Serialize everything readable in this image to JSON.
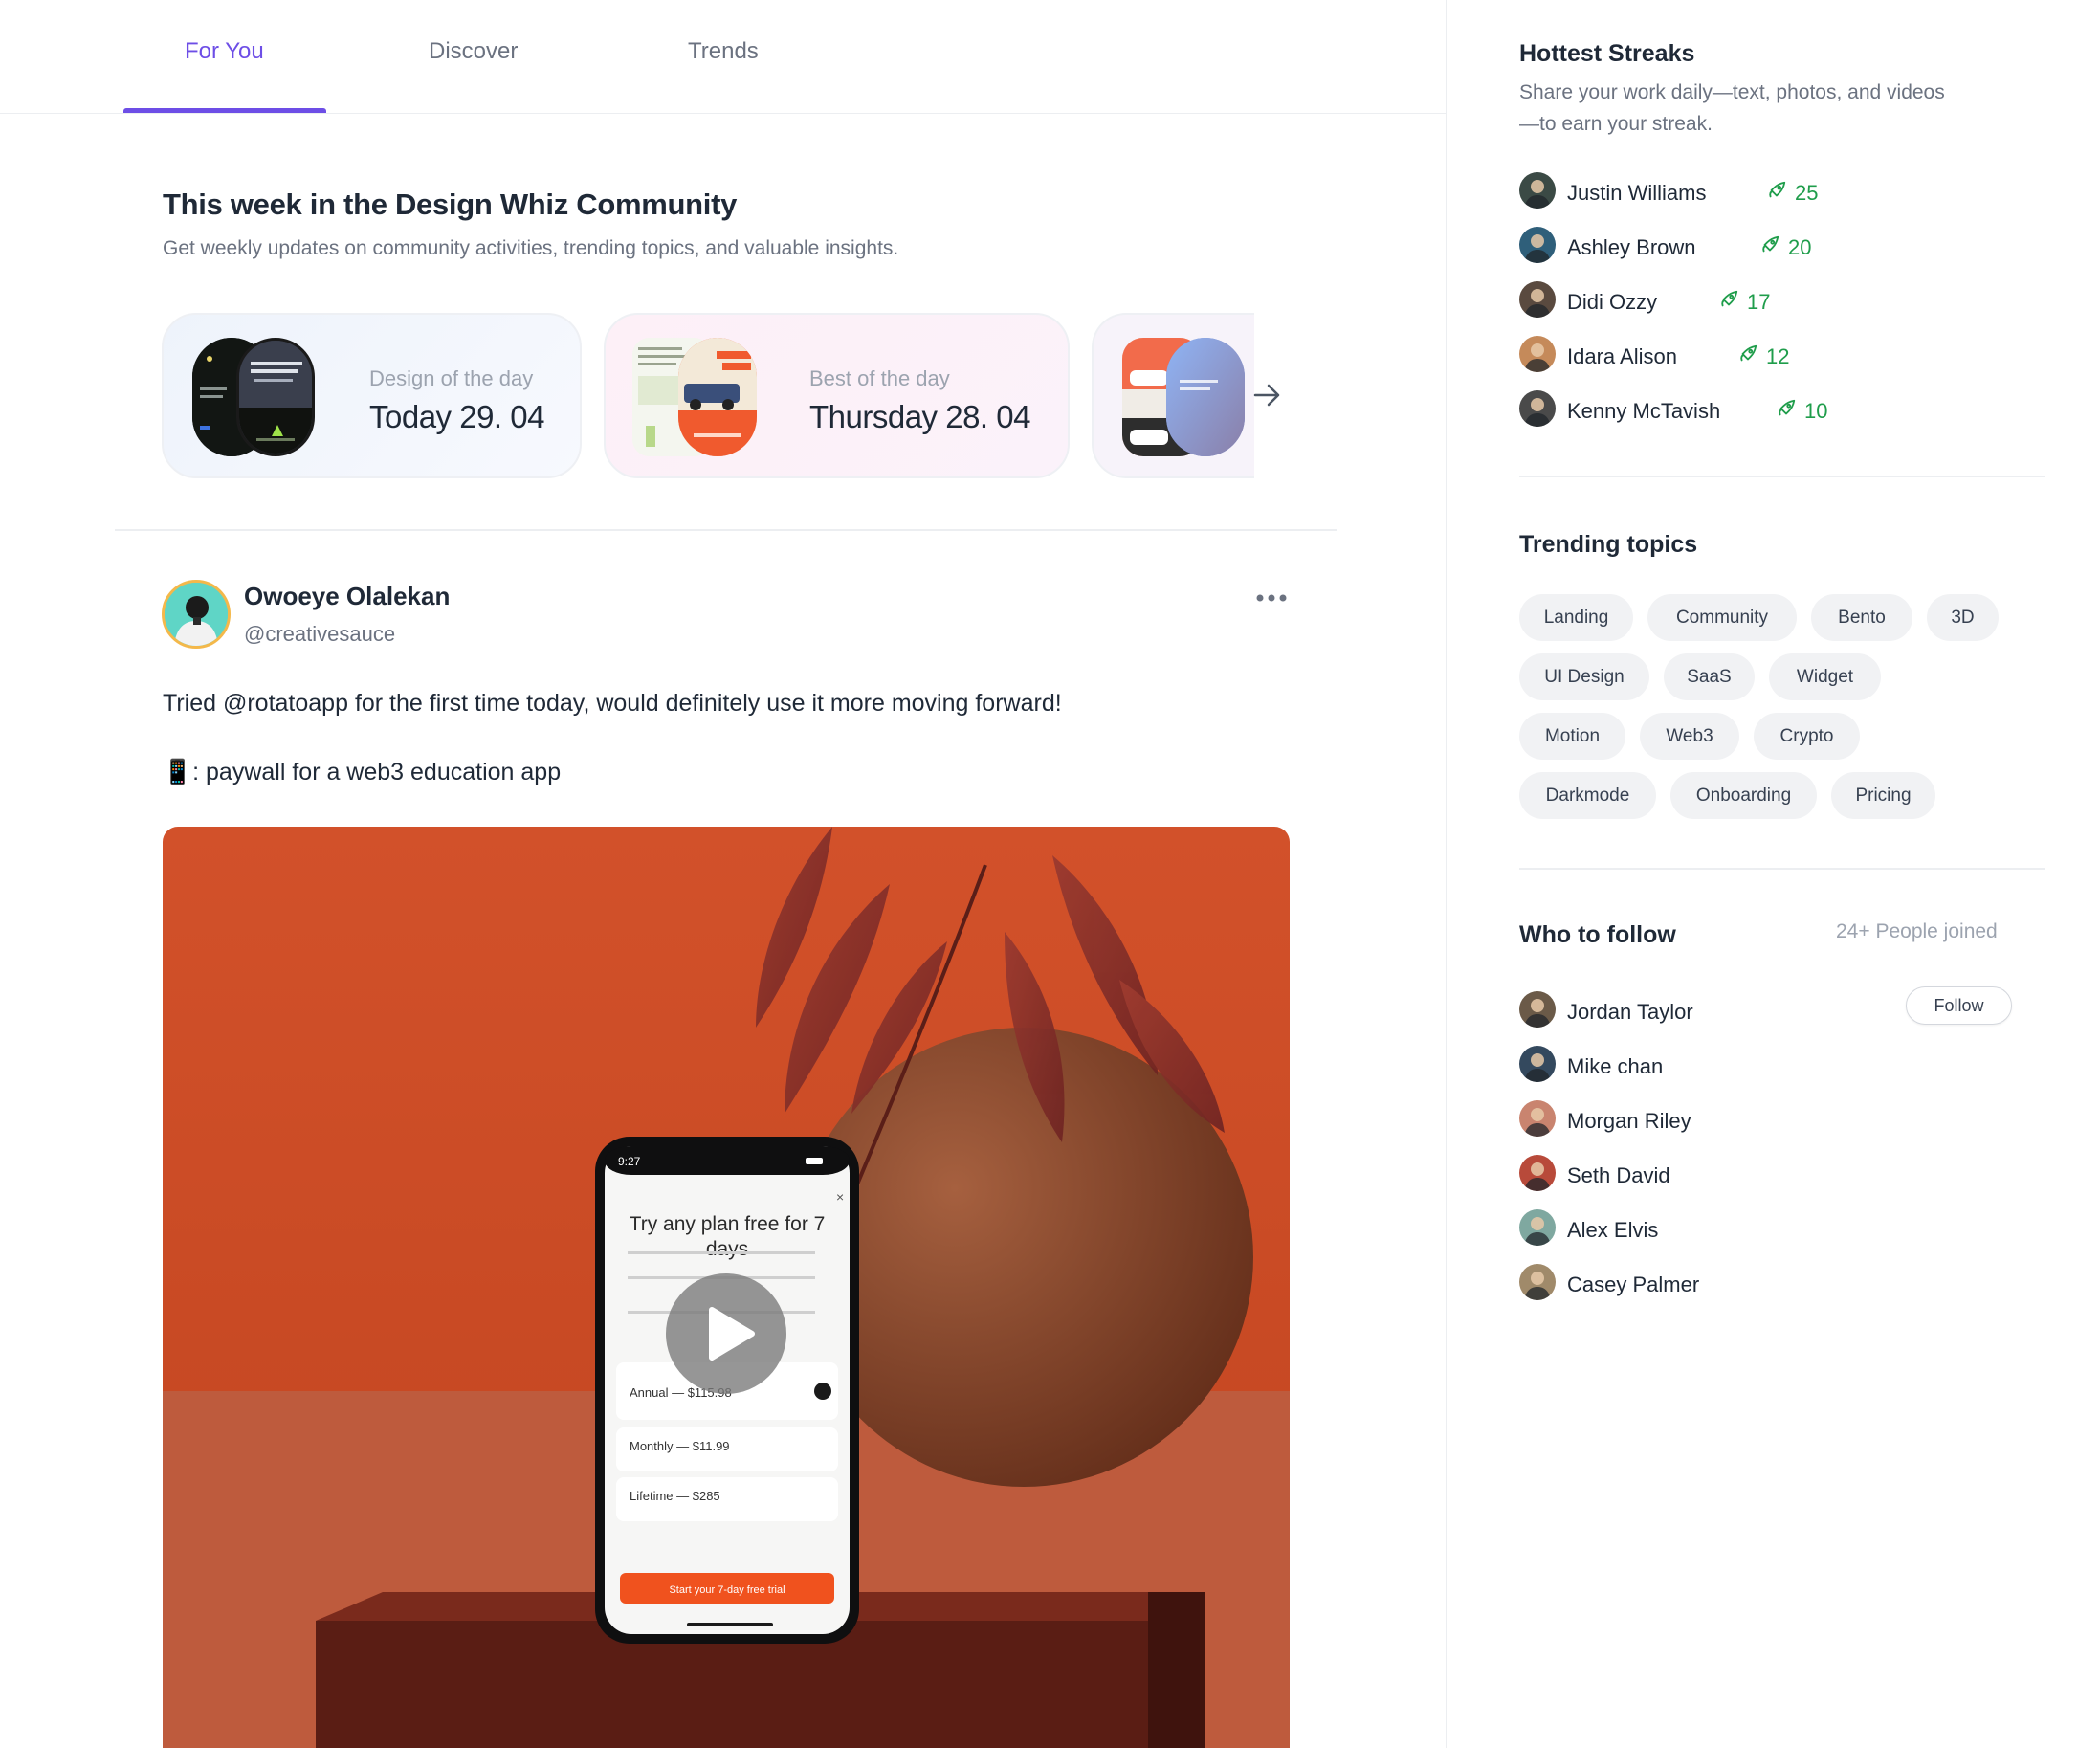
{
  "tabs": [
    {
      "label": "For You",
      "active": true
    },
    {
      "label": "Discover",
      "active": false
    },
    {
      "label": "Trends",
      "active": false
    }
  ],
  "weekly": {
    "title": "This week in the Design Whiz Community",
    "subtitle": "Get weekly updates on community activities, trending topics, and valuable insights.",
    "cards": [
      {
        "label": "Design of the day",
        "date": "Today 29. 04"
      },
      {
        "label": "Best of the day",
        "date": "Thursday 28. 04"
      }
    ]
  },
  "post": {
    "author": "Owoeye Olalekan",
    "handle": "@creativesauce",
    "text1": "Tried  @rotatoapp  for the first time today, would definitely use it more moving forward!",
    "text2": "📱: paywall for a web3 education app",
    "media": {
      "status_time": "9:27",
      "heading": "Try any plan free for 7 days",
      "plans": [
        "Annual — $115.98",
        "Monthly — $11.99",
        "Lifetime — $285"
      ],
      "cta": "Start your 7-day free trial"
    }
  },
  "streaks": {
    "title": "Hottest Streaks",
    "subtitle": "Share your work daily—text, photos, and videos—to earn your streak.",
    "people": [
      {
        "name": "Justin Williams",
        "count": "25",
        "avatar_color": "#3b4a45"
      },
      {
        "name": "Ashley Brown",
        "count": "20",
        "avatar_color": "#2f5f7a"
      },
      {
        "name": "Didi Ozzy",
        "count": "17",
        "avatar_color": "#5a4a3f"
      },
      {
        "name": "Idara Alison",
        "count": "12",
        "avatar_color": "#c58a5a"
      },
      {
        "name": "Kenny McTavish",
        "count": "10",
        "avatar_color": "#4a4a4a"
      }
    ]
  },
  "trending": {
    "title": "Trending topics",
    "chips": [
      "Landing",
      "Community",
      "Bento",
      "3D",
      "UI Design",
      "SaaS",
      "Widget",
      "Motion",
      "Web3",
      "Crypto",
      "Darkmode",
      "Onboarding",
      "Pricing"
    ]
  },
  "follow": {
    "title": "Who to follow",
    "joined": "24+ People joined",
    "follow_label": "Follow",
    "people": [
      {
        "name": "Jordan Taylor",
        "avatar_color": "#6b5a48"
      },
      {
        "name": "Mike chan",
        "avatar_color": "#34495e"
      },
      {
        "name": "Morgan Riley",
        "avatar_color": "#c9846f"
      },
      {
        "name": "Seth David",
        "avatar_color": "#b84a3a"
      },
      {
        "name": "Alex Elvis",
        "avatar_color": "#7fa8a0"
      },
      {
        "name": "Casey Palmer",
        "avatar_color": "#a08a6a"
      }
    ]
  },
  "colors": {
    "accent": "#6d4ee6",
    "streak_green": "#1f9d4b",
    "media_bg": "#c94b25"
  }
}
